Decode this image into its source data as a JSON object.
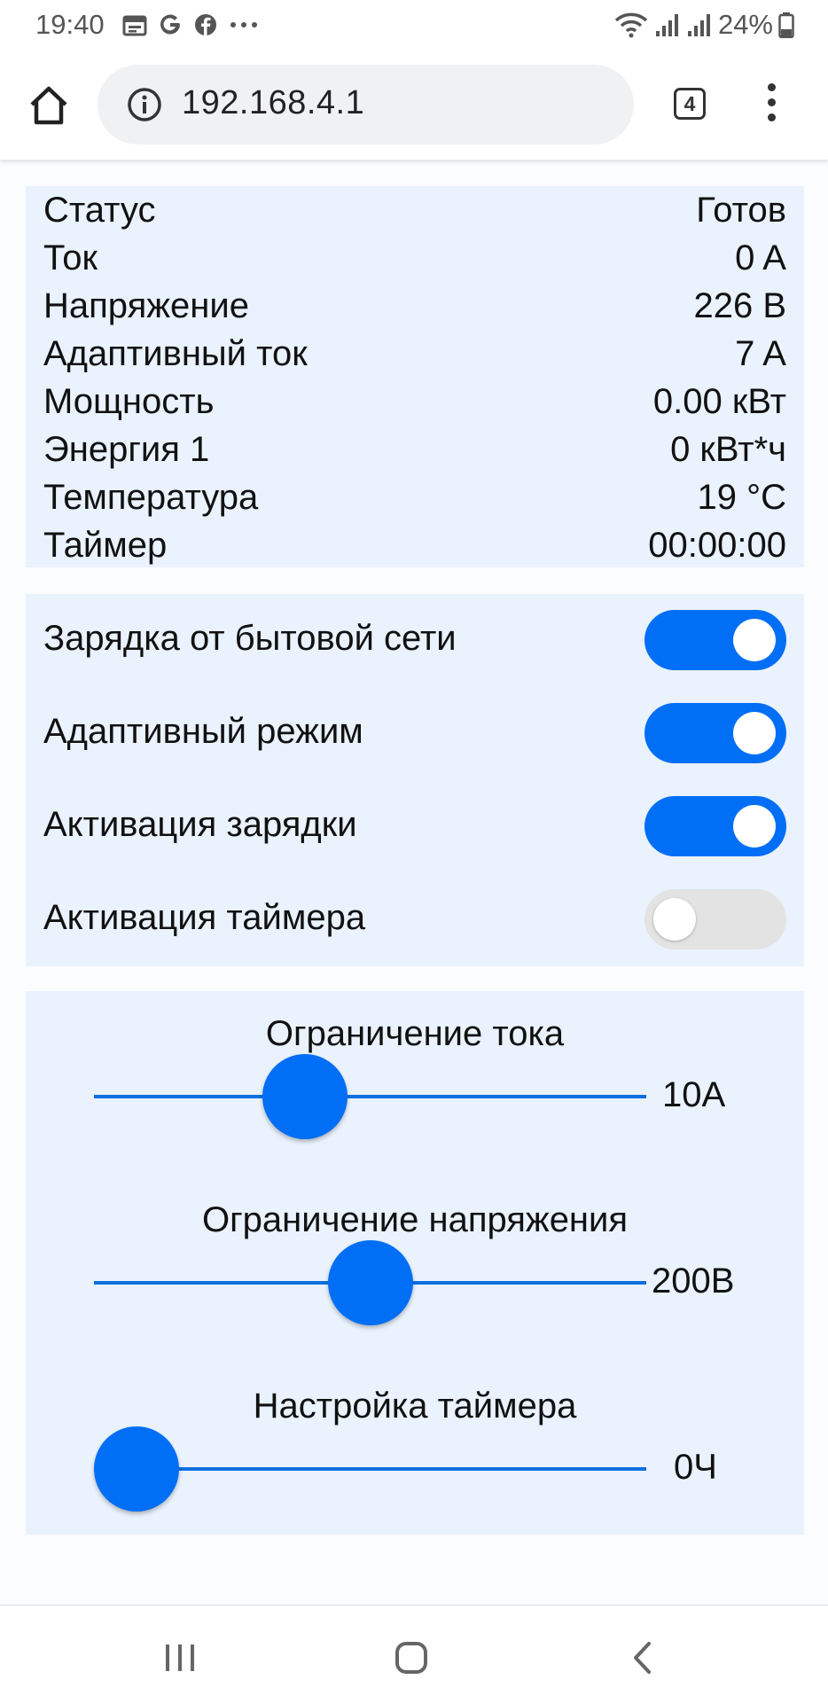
{
  "status_bar": {
    "time": "19:40",
    "left_icons": [
      "calendar-icon",
      "google-icon",
      "facebook-icon",
      "more-dots-icon"
    ],
    "right_icons": [
      "wifi-icon",
      "signal-icon",
      "signal-icon"
    ],
    "battery": "24%"
  },
  "browser": {
    "url": "192.168.4.1",
    "tab_count": "4"
  },
  "status": {
    "rows": [
      {
        "label": "Статус",
        "value": "Готов"
      },
      {
        "label": "Ток",
        "value": "0 A"
      },
      {
        "label": "Напряжение",
        "value": "226 В"
      },
      {
        "label": "Адаптивный ток",
        "value": "7 A"
      },
      {
        "label": "Мощность",
        "value": "0.00 кВт"
      },
      {
        "label": "Энергия 1",
        "value": "0 кВт*ч"
      },
      {
        "label": "Температура",
        "value": "19 °C"
      },
      {
        "label": "Таймер",
        "value": "00:00:00"
      }
    ]
  },
  "toggles": [
    {
      "label": "Зарядка от бытовой сети",
      "on": true
    },
    {
      "label": "Адаптивный режим",
      "on": true
    },
    {
      "label": "Активация зарядки",
      "on": true
    },
    {
      "label": "Активация таймера",
      "on": false
    }
  ],
  "sliders": [
    {
      "title": "Ограничение тока",
      "value": "10A",
      "position_fraction": 0.36
    },
    {
      "title": "Ограничение напряжения",
      "value": "200В",
      "position_fraction": 0.5
    },
    {
      "title": "Настройка таймера",
      "value": "0Ч",
      "position_fraction": 0.0
    }
  ],
  "colors": {
    "accent": "#006ef5",
    "panel_background": "#e9f2fd",
    "toggle_off": "#e3e3e3"
  }
}
